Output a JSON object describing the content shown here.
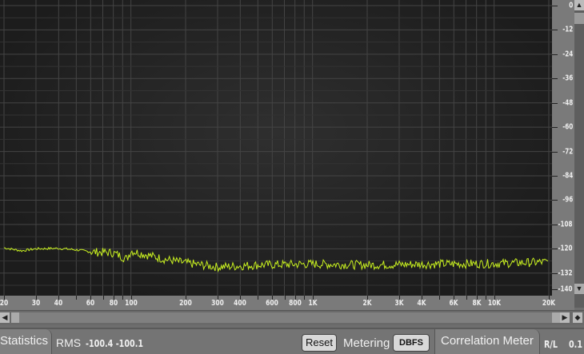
{
  "y_axis": {
    "labels": [
      "0",
      "-12",
      "-24",
      "-36",
      "-48",
      "-60",
      "-72",
      "-84",
      "-96",
      "-108",
      "-120",
      "-132",
      "-140"
    ],
    "values": [
      0,
      -12,
      -24,
      -36,
      -48,
      -60,
      -72,
      -84,
      -96,
      -108,
      -120,
      -132,
      -140
    ]
  },
  "x_axis": {
    "labels": [
      "20",
      "30",
      "40",
      "60",
      "80",
      "100",
      "200",
      "300",
      "400",
      "600",
      "800",
      "1K",
      "2K",
      "3K",
      "4K",
      "6K",
      "8K",
      "10K",
      "20K"
    ],
    "values": [
      20,
      30,
      40,
      60,
      80,
      100,
      200,
      300,
      400,
      600,
      800,
      1000,
      2000,
      3000,
      4000,
      6000,
      8000,
      10000,
      20000
    ],
    "grid": [
      20,
      30,
      40,
      50,
      60,
      70,
      80,
      90,
      100,
      200,
      300,
      400,
      500,
      600,
      700,
      800,
      900,
      1000,
      2000,
      3000,
      4000,
      5000,
      6000,
      7000,
      8000,
      9000,
      10000,
      20000
    ]
  },
  "spectrum": {
    "color": "#c8f020",
    "points": [
      [
        20,
        -119.5
      ],
      [
        25,
        -121
      ],
      [
        30,
        -120
      ],
      [
        40,
        -119.8
      ],
      [
        50,
        -120.5
      ],
      [
        60,
        -121.5
      ],
      [
        80,
        -122
      ],
      [
        95,
        -125
      ],
      [
        100,
        -121
      ],
      [
        150,
        -125
      ],
      [
        200,
        -127
      ],
      [
        300,
        -129
      ],
      [
        500,
        -128
      ],
      [
        1000,
        -127.5
      ],
      [
        2000,
        -128
      ],
      [
        5000,
        -127.5
      ],
      [
        10000,
        -127.3
      ],
      [
        20000,
        -126.5
      ]
    ]
  },
  "statistics": {
    "tab": "Statistics",
    "rms_label": "RMS",
    "rms_values": "-100.4 -100.1",
    "reset": "Reset",
    "metering_label": "Metering",
    "metering_value": "DBFS"
  },
  "correlation": {
    "tab": "Correlation Meter",
    "label": "R/L",
    "value": "0.1"
  }
}
